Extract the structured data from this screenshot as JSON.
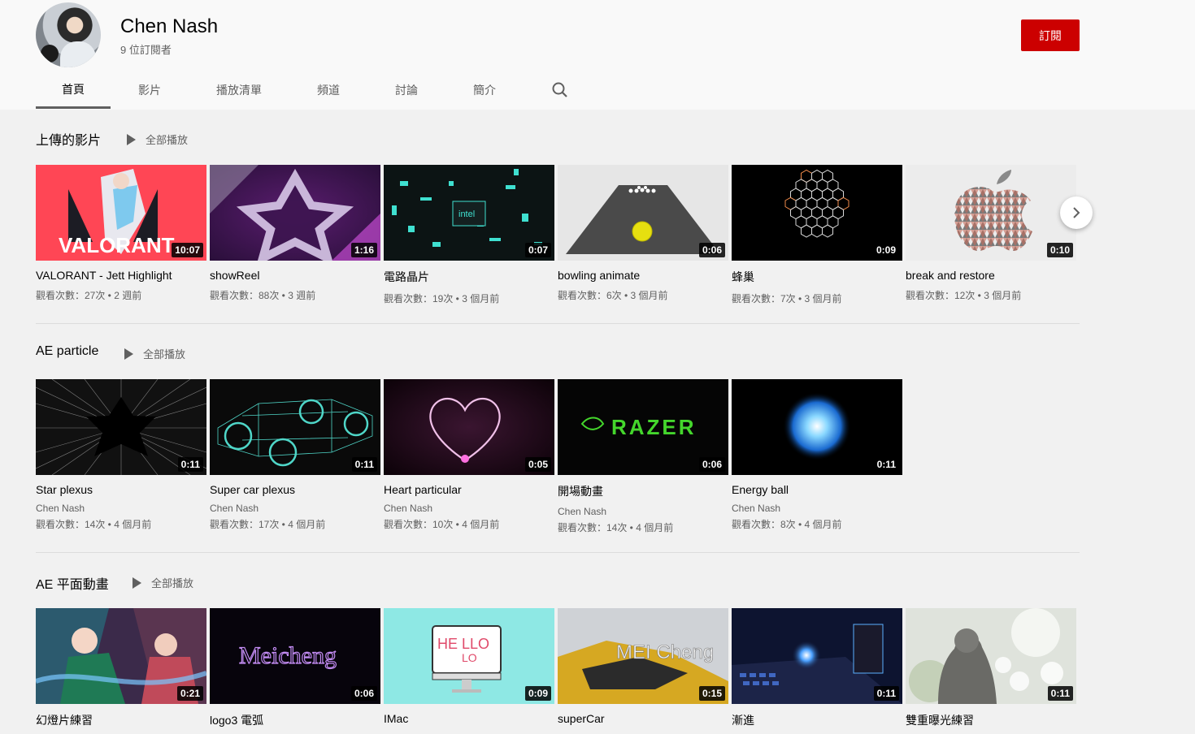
{
  "channel": {
    "name": "Chen Nash",
    "subscribers": "9 位訂閱者",
    "subscribe_label": "訂閱"
  },
  "tabs": [
    {
      "label": "首頁",
      "active": true
    },
    {
      "label": "影片"
    },
    {
      "label": "播放清單"
    },
    {
      "label": "頻道"
    },
    {
      "label": "討論"
    },
    {
      "label": "簡介"
    }
  ],
  "play_all_label": "全部播放",
  "sections": [
    {
      "title": "上傳的影片",
      "videos": [
        {
          "title": "VALORANT - Jett Highlight",
          "duration": "10:07",
          "meta": "觀看次數：27次 • 2 週前",
          "thumb": "valorant"
        },
        {
          "title": "showReel",
          "duration": "1:16",
          "meta": "觀看次數：88次 • 3 週前",
          "thumb": "star-purple"
        },
        {
          "title": "電路晶片",
          "duration": "0:07",
          "meta": "觀看次數：19次 • 3 個月前",
          "thumb": "chip"
        },
        {
          "title": "bowling animate",
          "duration": "0:06",
          "meta": "觀看次數：6次 • 3 個月前",
          "thumb": "bowling"
        },
        {
          "title": "蜂巢",
          "duration": "0:09",
          "meta": "觀看次數：7次 • 3 個月前",
          "thumb": "hexagon"
        },
        {
          "title": "break and restore",
          "duration": "0:10",
          "meta": "觀看次數：12次 • 3 個月前",
          "thumb": "apple"
        }
      ]
    },
    {
      "title": "AE particle",
      "videos": [
        {
          "title": "Star plexus",
          "duration": "0:11",
          "channel": "Chen Nash",
          "meta": "觀看次數：14次 • 4 個月前",
          "thumb": "plexus"
        },
        {
          "title": "Super car plexus",
          "duration": "0:11",
          "channel": "Chen Nash",
          "meta": "觀看次數：17次 • 4 個月前",
          "thumb": "car-plexus"
        },
        {
          "title": "Heart particular",
          "duration": "0:05",
          "channel": "Chen Nash",
          "meta": "觀看次數：10次 • 4 個月前",
          "thumb": "heart"
        },
        {
          "title": "開場動畫",
          "duration": "0:06",
          "channel": "Chen Nash",
          "meta": "觀看次數：14次 • 4 個月前",
          "thumb": "razer"
        },
        {
          "title": "Energy ball",
          "duration": "0:11",
          "channel": "Chen Nash",
          "meta": "觀看次數：8次 • 4 個月前",
          "thumb": "energy"
        }
      ]
    },
    {
      "title": "AE 平面動畫",
      "videos": [
        {
          "title": "幻燈片練習",
          "duration": "0:21",
          "thumb": "anime"
        },
        {
          "title": "logo3 電弧",
          "duration": "0:06",
          "thumb": "meicheng"
        },
        {
          "title": "IMac",
          "duration": "0:09",
          "thumb": "imac"
        },
        {
          "title": "superCar",
          "duration": "0:15",
          "thumb": "supercar"
        },
        {
          "title": "漸進",
          "duration": "0:11",
          "thumb": "keyboard"
        },
        {
          "title": "雙重曝光練習",
          "duration": "0:11",
          "thumb": "double-exposure"
        }
      ]
    }
  ],
  "thumb_text": {
    "valorant": "VALORANT",
    "chip": "intel",
    "razer": "RAZER",
    "meicheng": "Meicheng",
    "supercar": "MEI Cheng",
    "imac_line1": "HE LLO",
    "imac_line2": "LO"
  },
  "colors": {
    "accent": "#cc0000",
    "page_bg": "#f1f1f1",
    "header_bg": "#f9f9f9"
  },
  "icons": {
    "search": "search-icon",
    "next": "chevron-right-icon",
    "play_all": "play-icon"
  }
}
